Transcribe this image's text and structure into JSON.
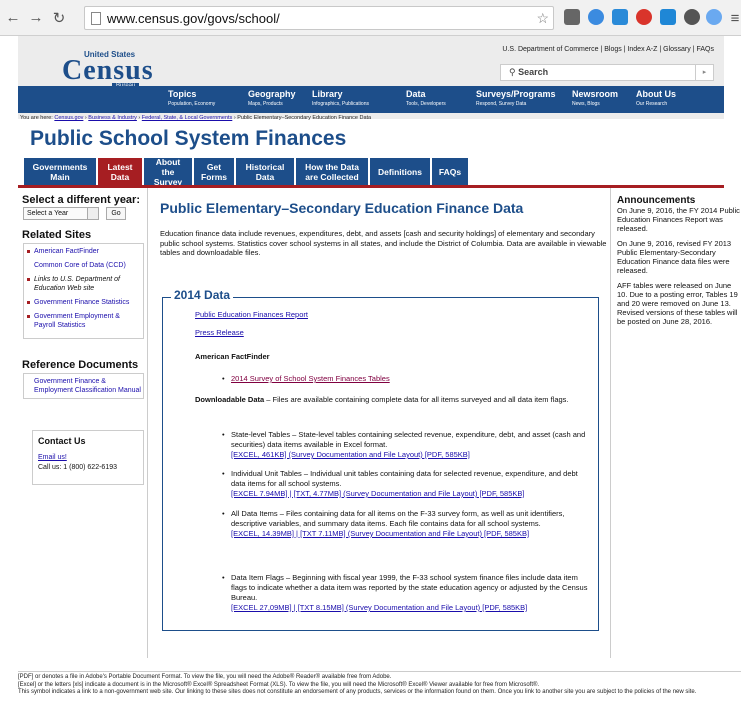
{
  "browser": {
    "url": "www.census.gov/govs/school/"
  },
  "header": {
    "top_links": [
      "U.S. Department of Commerce",
      "Blogs",
      "Index A-Z",
      "Glossary",
      "FAQs"
    ],
    "logo": {
      "line1": "United States",
      "line2": "Census",
      "line3": "Bureau"
    },
    "search_placeholder": "Search",
    "nav": [
      {
        "label": "Topics",
        "sub": "Population, Economy"
      },
      {
        "label": "Geography",
        "sub": "Maps, Products"
      },
      {
        "label": "Library",
        "sub": "Infographics, Publications"
      },
      {
        "label": "Data",
        "sub": "Tools, Developers"
      },
      {
        "label": "Surveys/Programs",
        "sub": "Respond, Survey Data"
      },
      {
        "label": "Newsroom",
        "sub": "News, Blogs"
      },
      {
        "label": "About Us",
        "sub": "Our Research"
      }
    ]
  },
  "breadcrumb": {
    "prefix": "You are here:",
    "items": [
      "Census.gov",
      "Business & Industry",
      "Federal, State, & Local Governments"
    ],
    "current": "Public Elementary–Secondary Education Finance Data"
  },
  "page_title": "Public School System Finances",
  "tabs": [
    {
      "l1": "Governments",
      "l2": "Main"
    },
    {
      "l1": "Latest",
      "l2": "Data"
    },
    {
      "l1": "About the",
      "l2": "Survey"
    },
    {
      "l1": "Get",
      "l2": "Forms"
    },
    {
      "l1": "Historical",
      "l2": "Data"
    },
    {
      "l1": "How the Data",
      "l2": "are Collected"
    },
    {
      "l1": "Definitions",
      "l2": ""
    },
    {
      "l1": "FAQs",
      "l2": ""
    }
  ],
  "sidebar": {
    "year_heading": "Select a different year:",
    "year_select": "Select a Year",
    "go": "Go",
    "related_heading": "Related Sites",
    "related": [
      "American FactFinder",
      "Common Core of Data (CCD)",
      "Links to U.S. Department of Education Web site",
      "Government Finance Statistics",
      "Government Employment & Payroll Statistics"
    ],
    "ref_heading": "Reference Documents",
    "ref": [
      "Government Finance & Employment Classification Manual"
    ],
    "contact_heading": "Contact Us",
    "contact_email": "Email us!",
    "contact_phone": "Call us: 1 (800) 622-6193"
  },
  "main": {
    "heading": "Public Elementary–Secondary Education Finance Data",
    "intro": "Education finance data include revenues, expenditures, debt, and assets [cash and security holdings] of elementary and secondary public school systems. Statistics cover school systems in all states, and include the District of Columbia. Data are available in viewable tables and downloadable files.",
    "legend": "2014 Data",
    "report_link": "Public Education Finances Report",
    "press_link": "Press Release",
    "aff_heading": "American FactFinder",
    "aff_link": "2014 Survey of School System Finances Tables",
    "dl_bold": "Downloadable Data",
    "dl_text": " – Files are available containing complete data for all items surveyed and all data item flags.",
    "items": [
      {
        "text": "State-level Tables – State-level tables containing selected revenue, expenditure, debt, and asset (cash and securities) data items available in Excel format.",
        "links": "[EXCEL, 461KB] (Survey Documentation and File Layout) [PDF, 585KB]"
      },
      {
        "text": "Individual Unit Tables – Individual unit tables containing data for selected revenue, expenditure, and debt data items for all school systems.",
        "links": "[EXCEL 7.94MB]  |  [TXT, 4.77MB] (Survey Documentation and File Layout) [PDF, 585KB]"
      },
      {
        "text": "All Data Items – Files containing data for all items on the F-33 survey form, as well as unit identifiers, descriptive variables, and summary data items. Each file contains data for all school systems.",
        "links": "[EXCEL, 14.39MB]  |  [TXT 7.11MB] (Survey Documentation and File Layout) [PDF, 585KB]"
      },
      {
        "text": "Data Item Flags – Beginning with fiscal year 1999, the F-33 school system finance files include data item flags to indicate whether a data item was reported by the state education agency or adjusted by the Census Bureau.",
        "links": "[EXCEL 27,09MB]  |  [TXT 8.15MB] (Survey Documentation and File Layout) [PDF, 585KB]"
      }
    ]
  },
  "announcements": {
    "heading": "Announcements",
    "items": [
      "On June 9, 2016, the FY 2014 Public Education Finances Report was released.",
      "On June 9, 2016, revised FY 2013 Public Elementary-Secondary Education Finance data files were released.",
      "AFF tables were released on June 10. Due to a posting error, Tables 19 and 20 were removed on June 13. Revised versions of these tables will be posted on June 28, 2016."
    ]
  },
  "footer": [
    "[PDF] or  denotes a file in Adobe's Portable Document Format. To view the file, you will need the Adobe® Reader®  available free from Adobe.",
    "[Excel] or the letters [xls] indicate a document is in the Microsoft® Excel® Spreadsheet Format (XLS). To view the file, you will need the Microsoft® Excel® Viewer  available for free from Microsoft®.",
    "This symbol  indicates a link to a non-government web site. Our linking to these sites does not constitute an endorsement of any products, services or the information found on them. Once you link to another site you are subject to the policies of the new site."
  ]
}
